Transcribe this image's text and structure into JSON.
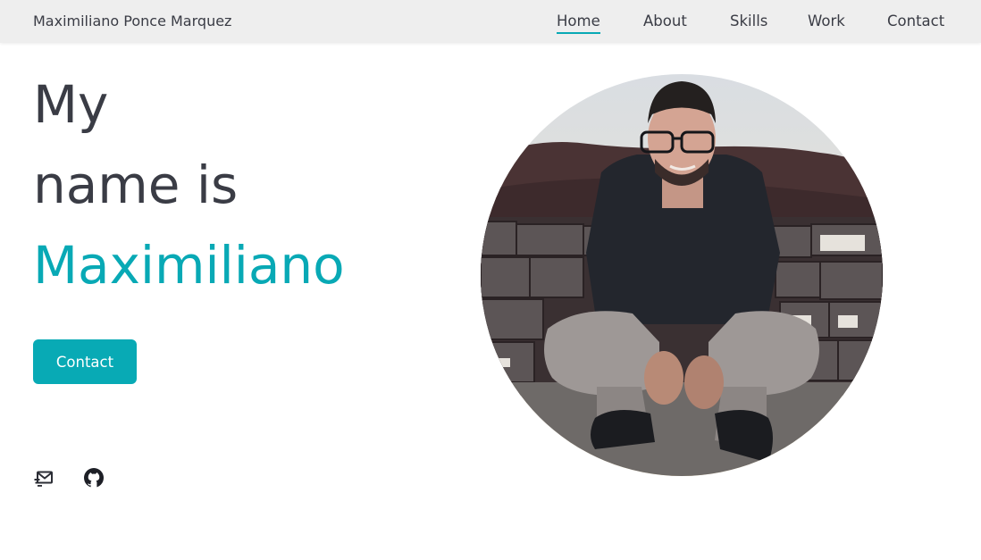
{
  "header": {
    "brand": "Maximiliano Ponce Marquez",
    "nav": [
      {
        "label": "Home",
        "active": true
      },
      {
        "label": "About",
        "active": false
      },
      {
        "label": "Skills",
        "active": false
      },
      {
        "label": "Work",
        "active": false
      },
      {
        "label": "Contact",
        "active": false
      }
    ]
  },
  "hero": {
    "line1": "My",
    "line2": "name is",
    "name": "Maximiliano",
    "contact_button": "Contact"
  },
  "social": {
    "email_icon": "mail-send-icon",
    "github_icon": "github-icon"
  },
  "colors": {
    "accent": "#08a9b5",
    "text": "#3a3c45",
    "header_bg": "#eeeeee"
  }
}
